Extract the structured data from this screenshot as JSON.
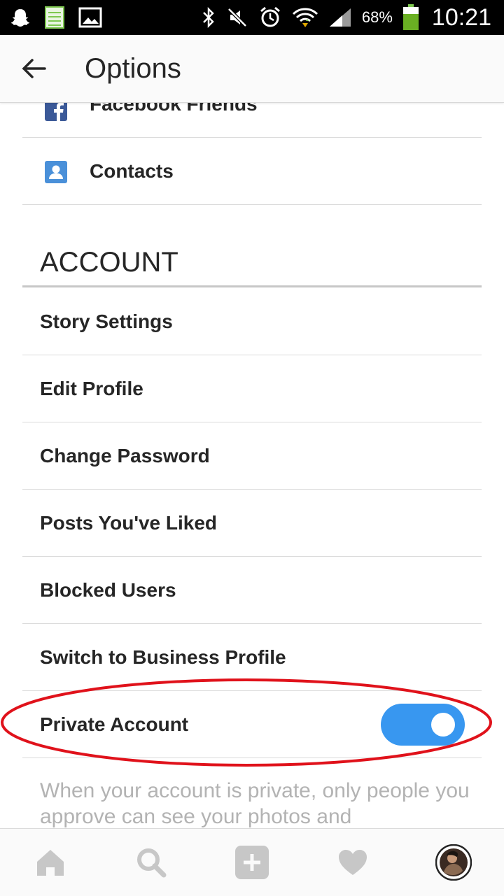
{
  "status_bar": {
    "battery_percent": "68%",
    "time": "10:21",
    "icons_left": [
      "snapchat-ghost-icon",
      "notes-icon",
      "gallery-icon"
    ],
    "icons_right": [
      "bluetooth-icon",
      "mute-icon",
      "alarm-icon",
      "wifi-icon",
      "signal-icon",
      "battery-icon"
    ],
    "battery_level": 0.68
  },
  "appbar": {
    "title": "Options"
  },
  "menu": {
    "top_items": [
      {
        "label": "Facebook Friends",
        "icon": "facebook-icon"
      },
      {
        "label": "Contacts",
        "icon": "contacts-icon"
      }
    ],
    "account_section_title": "ACCOUNT",
    "account_items": [
      {
        "label": "Story Settings"
      },
      {
        "label": "Edit Profile"
      },
      {
        "label": "Change Password"
      },
      {
        "label": "Posts You've Liked"
      },
      {
        "label": "Blocked Users"
      },
      {
        "label": "Switch to Business Profile"
      }
    ],
    "private_account": {
      "label": "Private Account",
      "enabled": true
    },
    "private_description": "When your account is private, only people you approve can see your photos and"
  },
  "bottom_nav": {
    "items": [
      "home-icon",
      "search-icon",
      "add-post-icon",
      "activity-heart-icon",
      "profile-avatar"
    ]
  },
  "colors": {
    "toggle_on": "#3897f0",
    "annotation_ellipse": "#e0121b",
    "facebook_blue": "#3b5998",
    "contacts_blue": "#4a90d9"
  }
}
